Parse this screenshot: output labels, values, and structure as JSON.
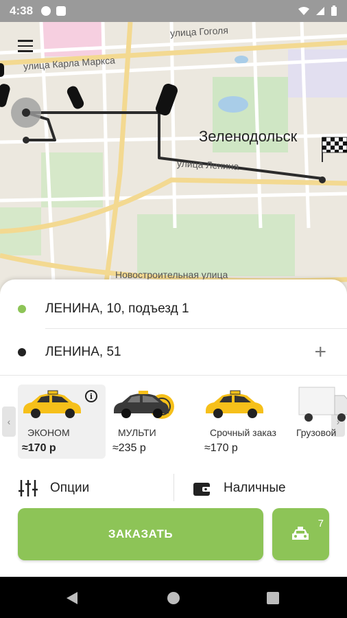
{
  "status_bar": {
    "time": "4:38"
  },
  "map": {
    "streets": [
      "улица Гоголя",
      "улица Карла Маркса",
      "улица Ленина",
      "Новостроительная улица"
    ],
    "city": "Зеленодольск"
  },
  "route": {
    "pickup": "ЛЕНИНА, 10, подъезд 1",
    "destination": "ЛЕНИНА, 51",
    "pickup_color": "#8dc457",
    "destination_color": "#222222"
  },
  "tariffs": [
    {
      "name": "ЭКОНОМ",
      "price": "≈170 р",
      "selected": true
    },
    {
      "name": "МУЛЬТИ",
      "price": "≈235 р",
      "selected": false
    },
    {
      "name": "Срочный заказ",
      "price": "≈170 р",
      "selected": false
    },
    {
      "name": "Грузовой",
      "price": "",
      "selected": false
    }
  ],
  "options": {
    "options_label": "Опции",
    "payment_label": "Наличные"
  },
  "order": {
    "label": "ЗАКАЗАТЬ",
    "taxi_count": "7"
  },
  "colors": {
    "accent": "#8dc457",
    "route_line": "#2b2b2b",
    "taxi_yellow": "#f6c01a"
  }
}
